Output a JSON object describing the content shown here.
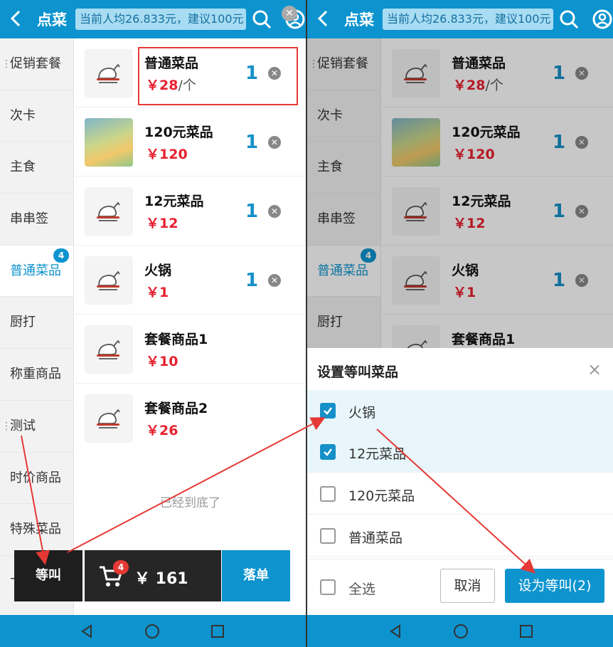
{
  "header": {
    "title": "点菜",
    "notice": "当前人均26.833元，建议100元"
  },
  "categories": [
    {
      "label": "促销套餐",
      "dots": "⋮",
      "badge": ""
    },
    {
      "label": "次卡",
      "dots": "",
      "badge": ""
    },
    {
      "label": "主食",
      "dots": "",
      "badge": ""
    },
    {
      "label": "串串签",
      "dots": "",
      "badge": ""
    },
    {
      "label": "普通菜品",
      "dots": "",
      "badge": "4"
    },
    {
      "label": "厨打",
      "dots": "",
      "badge": ""
    },
    {
      "label": "称重商品",
      "dots": "",
      "badge": ""
    },
    {
      "label": "测试",
      "dots": "⋮",
      "badge": ""
    },
    {
      "label": "时价商品",
      "dots": "",
      "badge": ""
    },
    {
      "label": "特殊菜品",
      "dots": "",
      "badge": ""
    }
  ],
  "hidden_category": "下火",
  "items": [
    {
      "name": "普通菜品",
      "price": "￥28",
      "unit": "/个",
      "qty": "1"
    },
    {
      "name": "120元菜品",
      "price": "￥120",
      "unit": "",
      "qty": "1"
    },
    {
      "name": "12元菜品",
      "price": "￥12",
      "unit": "",
      "qty": "1"
    },
    {
      "name": "火锅",
      "price": "￥1",
      "unit": "",
      "qty": "1"
    },
    {
      "name": "套餐商品1",
      "price": "￥10",
      "unit": "",
      "qty": ""
    },
    {
      "name": "套餐商品2",
      "price": "￥26",
      "unit": "",
      "qty": ""
    }
  ],
  "end_text": "已经到底了",
  "bottom": {
    "wait_label": "等叫",
    "cart_count": "4",
    "total": "￥ 161",
    "order_label": "落单"
  },
  "dialog": {
    "title": "设置等叫菜品",
    "close": "×",
    "options": [
      {
        "label": "火锅",
        "checked": true
      },
      {
        "label": "12元菜品",
        "checked": true
      },
      {
        "label": "120元菜品",
        "checked": false
      },
      {
        "label": "普通菜品",
        "checked": false
      }
    ],
    "select_all": "全选",
    "cancel": "取消",
    "confirm": "设为等叫(2)"
  },
  "colors": {
    "primary": "#0d94cf",
    "price": "#e8202f",
    "annotation": "#e53935"
  }
}
